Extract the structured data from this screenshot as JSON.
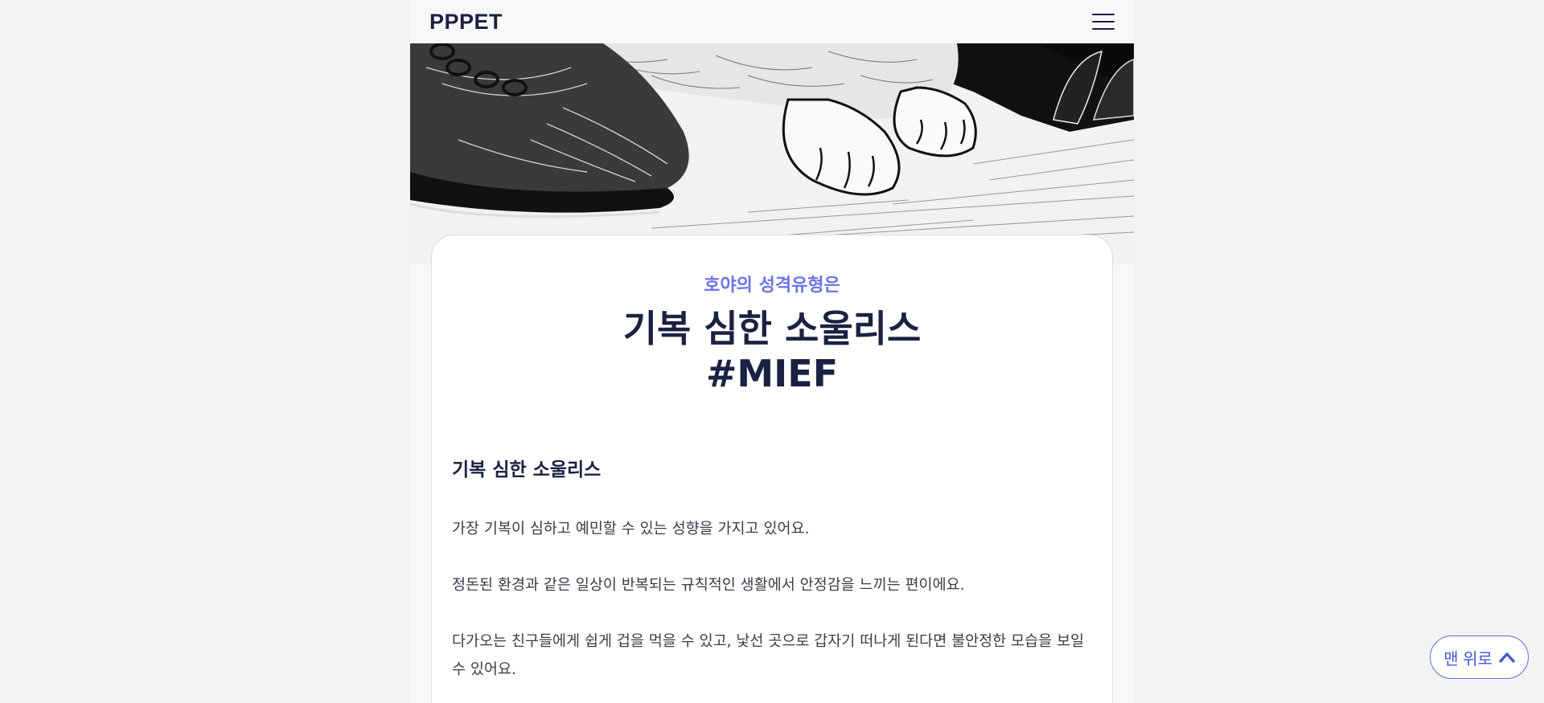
{
  "header": {
    "logo": "PPPET"
  },
  "result": {
    "subtitle": "호야의 성격유형은",
    "title_line1": "기복 심한 소울리스",
    "title_line2": "#MIEF",
    "section_heading": "기복 심한 소울리스",
    "paragraphs": [
      "가장 기복이 심하고 예민할 수 있는 성향을 가지고 있어요.",
      "정돈된 환경과 같은 일상이 반복되는 규칙적인 생활에서 안정감을 느끼는 편이에요.",
      "다가오는 친구들에게 쉽게 겁을 먹을 수 있고, 낯선 곳으로 갑자기 떠나게 된다면 불안정한 모습을 보일 수 있어요."
    ]
  },
  "scroll_top": {
    "label": "맨 위로",
    "icon": "chevron-up-icon"
  },
  "hero_image": {
    "icon": "cat-paws-and-shoe-illustration"
  },
  "colors": {
    "accent": "#6b74e8",
    "navy": "#1a2142",
    "button_border": "#5b6ee1"
  }
}
